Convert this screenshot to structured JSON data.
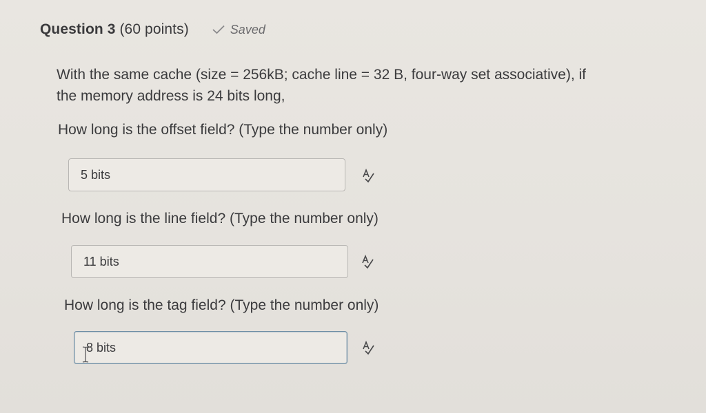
{
  "header": {
    "question_number": "Question 3",
    "points": "(60 points)",
    "saved_label": "Saved"
  },
  "prompt": {
    "line1": "With the same cache (size = 256kB; cache line = 32 B, four-way set associative), if",
    "line2": "the memory address is 24 bits long,"
  },
  "questions": [
    {
      "label": "How long is the offset field? (Type the number only)",
      "answer": "5 bits"
    },
    {
      "label": "How long is the line field? (Type the number only)",
      "answer": "11 bits"
    },
    {
      "label": "How long is the tag field? (Type the number only)",
      "answer": "8 bits"
    }
  ],
  "icons": {
    "saved": "check-icon",
    "spellcheck": "spellcheck-icon",
    "cursor": "text-cursor-icon"
  },
  "colors": {
    "background": "#e7e4df",
    "focused_border": "#6f8fa6"
  }
}
